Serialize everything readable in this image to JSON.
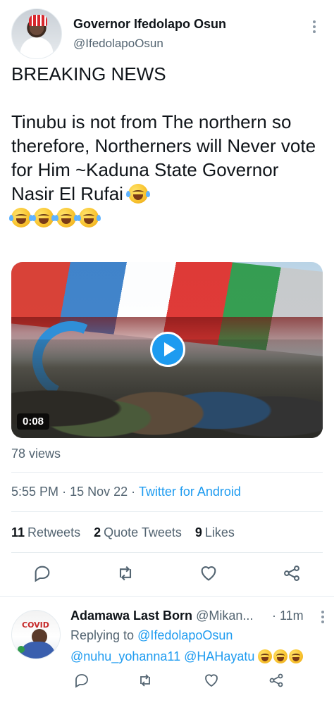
{
  "tweet": {
    "author": {
      "display_name": "Governor Ifedolapo Osun",
      "handle": "@IfedolapoOsun"
    },
    "text_lines": {
      "line1": "BREAKING NEWS",
      "line2": "Tinubu is not from The northern so therefore, Northerners will Never vote for Him ~Kaduna State Governor Nasir El Rufai"
    },
    "emoji_count_inline": 1,
    "emoji_count_line": 4,
    "media": {
      "duration": "0:08"
    },
    "views": "78 views",
    "meta": {
      "time": "5:55 PM",
      "separator": "·",
      "date": "15 Nov 22",
      "source": "Twitter for Android"
    },
    "stats": {
      "retweets_count": "11",
      "retweets_label": "Retweets",
      "quotes_count": "2",
      "quotes_label": "Quote Tweets",
      "likes_count": "9",
      "likes_label": "Likes"
    }
  },
  "reply": {
    "avatar_text": "COVID",
    "display_name": "Adamawa Last Born",
    "handle": "@Mikan...",
    "time": "· 11m",
    "replying_prefix": "Replying to",
    "replying_to": "@IfedolapoOsun",
    "mentions": "@nuhu_yohanna11 @HAHayatu"
  },
  "icons": {
    "reply": "reply-icon",
    "retweet": "retweet-icon",
    "like": "heart-icon",
    "share": "share-icon",
    "more": "more-icon",
    "play": "play-icon"
  },
  "colors": {
    "accent": "#1d9bf0",
    "muted": "#536471",
    "text": "#0f1419"
  }
}
